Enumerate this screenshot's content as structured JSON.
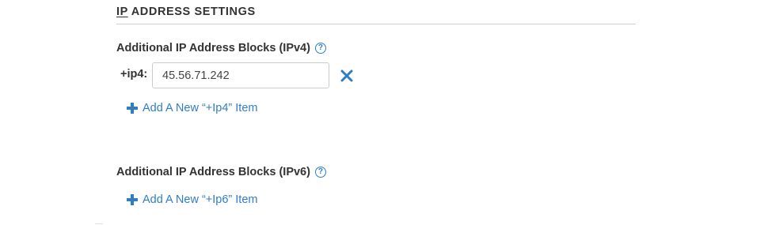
{
  "section": {
    "title_underlined": "IP",
    "title_rest": " ADDRESS SETTINGS"
  },
  "ipv4": {
    "label": "Additional IP Address Blocks (IPv4)",
    "help_icon": "question-circle-icon",
    "row_prefix": "+ip4:",
    "value": "45.56.71.242",
    "remove_icon": "close-x-icon",
    "add_label": "Add A New “+Ip4” Item",
    "add_icon": "plus-icon"
  },
  "ipv6": {
    "label": "Additional IP Address Blocks (IPv6)",
    "help_icon": "question-circle-icon",
    "add_label": "Add A New “+Ip6” Item",
    "add_icon": "plus-icon"
  },
  "colors": {
    "accent": "#2f7ec5",
    "text": "#333333",
    "rule": "#cfcfcf"
  }
}
